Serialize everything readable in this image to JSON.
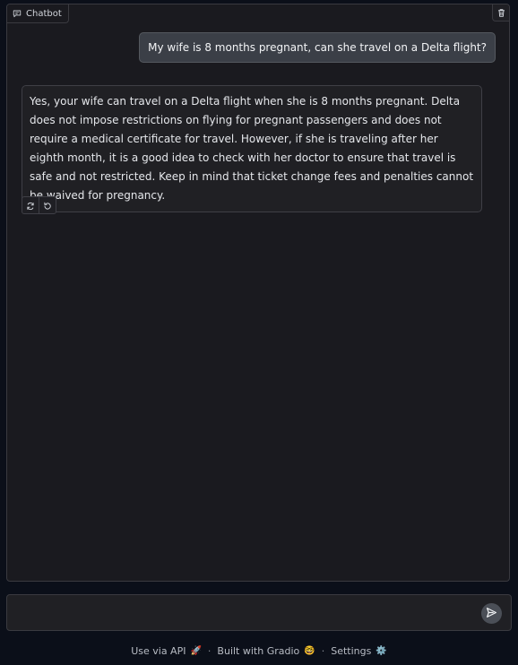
{
  "chatbot": {
    "label": "Chatbot",
    "messages": {
      "user": "My wife is 8 months pregnant, can she travel on a Delta flight?",
      "bot": "Yes, your wife can travel on a Delta flight when she is 8 months pregnant. Delta does not impose restrictions on flying for pregnant passengers and does not require a medical certificate for travel. However, if she is traveling after her eighth month, it is a good idea to check with her doctor to ensure that travel is safe and not restricted. Keep in mind that ticket change fees and penalties cannot be waived for pregnancy."
    },
    "actions": [
      "retry-icon",
      "undo-icon"
    ]
  },
  "input": {
    "value": "",
    "placeholder": ""
  },
  "footer": {
    "api_label": "Use via API",
    "api_emoji": "🚀",
    "separator": "·",
    "gradio_label": "Built with Gradio",
    "gradio_emoji": "🤓",
    "settings_label": "Settings",
    "settings_emoji": "⚙️"
  },
  "colors": {
    "background": "#0b0f19",
    "panel": "#1a1a1f",
    "user_bubble": "#3b3f47",
    "bot_bubble": "#202024",
    "border": "#3a3a40"
  }
}
